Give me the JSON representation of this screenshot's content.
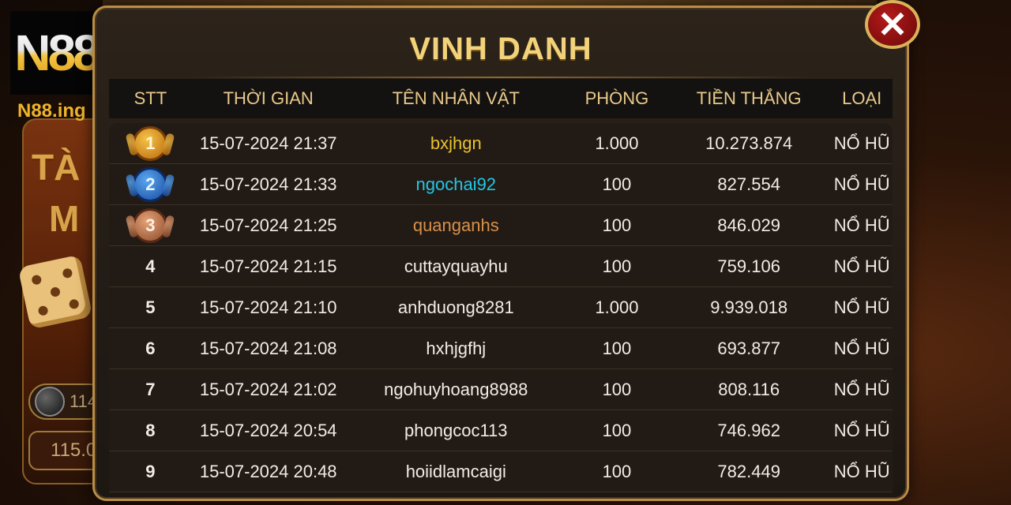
{
  "logo": {
    "text": "N88",
    "site": "N88.ing"
  },
  "background": {
    "title_line1": "TÀ",
    "title_line2": "M",
    "coin_value": "114",
    "pill_value": "115.0"
  },
  "panel": {
    "title": "VINH DANH",
    "close_icon": "close-icon"
  },
  "columns": [
    "STT",
    "THỜI GIAN",
    "TÊN NHÂN VẬT",
    "PHÒNG",
    "TIỀN THẮNG",
    "LOẠI"
  ],
  "rows": [
    {
      "rank": "1",
      "time": "15-07-2024 21:37",
      "name": "bxjhgn",
      "name_color": "#e8c12e",
      "room": "1.000",
      "win": "10.273.874",
      "type": "NỔ HŨ"
    },
    {
      "rank": "2",
      "time": "15-07-2024 21:33",
      "name": "ngochai92",
      "name_color": "#22c6e6",
      "room": "100",
      "win": "827.554",
      "type": "NỔ HŨ"
    },
    {
      "rank": "3",
      "time": "15-07-2024 21:25",
      "name": "quanganhs",
      "name_color": "#d9904a",
      "room": "100",
      "win": "846.029",
      "type": "NỔ HŨ"
    },
    {
      "rank": "4",
      "time": "15-07-2024 21:15",
      "name": "cuttayquayhu",
      "name_color": "#f1ece4",
      "room": "100",
      "win": "759.106",
      "type": "NỔ HŨ"
    },
    {
      "rank": "5",
      "time": "15-07-2024 21:10",
      "name": "anhduong8281",
      "name_color": "#f1ece4",
      "room": "1.000",
      "win": "9.939.018",
      "type": "NỔ HŨ"
    },
    {
      "rank": "6",
      "time": "15-07-2024 21:08",
      "name": "hxhjgfhj",
      "name_color": "#f1ece4",
      "room": "100",
      "win": "693.877",
      "type": "NỔ HŨ"
    },
    {
      "rank": "7",
      "time": "15-07-2024 21:02",
      "name": "ngohuyhoang8988",
      "name_color": "#f1ece4",
      "room": "100",
      "win": "808.116",
      "type": "NỔ HŨ"
    },
    {
      "rank": "8",
      "time": "15-07-2024 20:54",
      "name": "phongcoc113",
      "name_color": "#f1ece4",
      "room": "100",
      "win": "746.962",
      "type": "NỔ HŨ"
    },
    {
      "rank": "9",
      "time": "15-07-2024 20:48",
      "name": "hoiidlamcaigi",
      "name_color": "#f1ece4",
      "room": "100",
      "win": "782.449",
      "type": "NỔ HŨ"
    }
  ],
  "colors": {
    "accent_gold": "#f2d27a",
    "header_text": "#e9c98a",
    "panel_border": "#b98d45"
  }
}
